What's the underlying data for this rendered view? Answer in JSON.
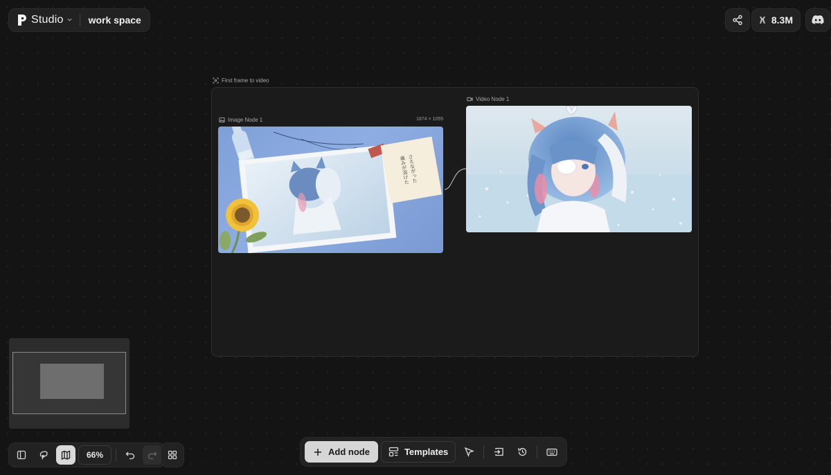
{
  "header": {
    "app_name": "Studio",
    "workspace_name": "work space"
  },
  "topbar_right": {
    "credits_value": "8.3M",
    "icons": [
      "share-icon",
      "credits-icon",
      "discord-icon"
    ]
  },
  "canvas": {
    "group": {
      "label": "First frame to video",
      "nodes": [
        {
          "label": "Image Node 1",
          "dimensions": "1874 × 1055",
          "type": "image"
        },
        {
          "label": "Video Node 1",
          "type": "video"
        }
      ]
    },
    "image_node_text": "さえながった\n痛みが溶けた"
  },
  "view_toolbar": {
    "zoom_label": "66%",
    "icons": [
      "sidebar-toggle-icon",
      "lasso-icon",
      "map-icon",
      "undo-icon",
      "redo-icon",
      "grid-icon"
    ]
  },
  "main_toolbar": {
    "add_node_label": "Add node",
    "templates_label": "Templates",
    "icons": [
      "plus-icon",
      "templates-icon",
      "pointer-icon",
      "import-icon",
      "history-icon",
      "keyboard-icon"
    ]
  },
  "colors": {
    "background": "#141414",
    "panel": "#222222",
    "active_button": "#d6d6d6"
  }
}
